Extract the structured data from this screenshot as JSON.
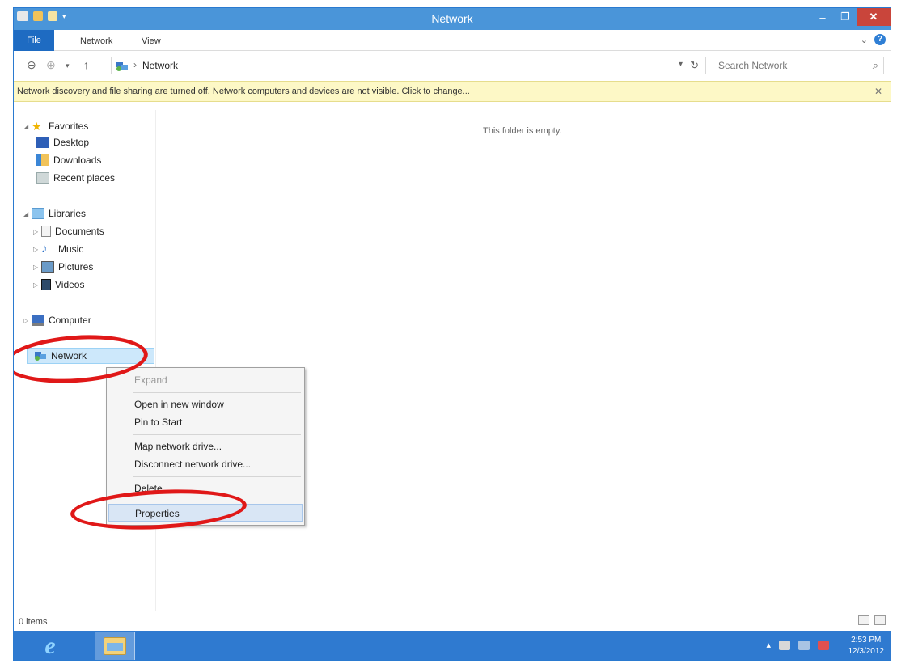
{
  "window": {
    "title": "Network"
  },
  "ribbon": {
    "tabs": [
      "File",
      "Network",
      "View"
    ]
  },
  "address_bar": {
    "crumb": "Network",
    "separator": "›",
    "search_placeholder": "Search Network"
  },
  "info_bar": {
    "message": "Network discovery and file sharing are turned off. Network computers and devices are not visible. Click to change..."
  },
  "nav_pane": {
    "favorites": {
      "label": "Favorites",
      "items": [
        "Desktop",
        "Downloads",
        "Recent places"
      ]
    },
    "libraries": {
      "label": "Libraries",
      "items": [
        "Documents",
        "Music",
        "Pictures",
        "Videos"
      ]
    },
    "computer": "Computer",
    "network": "Network"
  },
  "content": {
    "empty_message": "This folder is empty."
  },
  "context_menu": {
    "items": [
      "Expand",
      "Open in new window",
      "Pin to Start",
      "Map network drive...",
      "Disconnect network drive...",
      "Delete",
      "Properties"
    ],
    "highlighted": "Properties"
  },
  "status_bar": {
    "item_count": "0 items"
  },
  "taskbar": {
    "time": "2:53 PM",
    "date": "12/3/2012"
  },
  "colors": {
    "titlebar": "#4a95d9",
    "taskbar": "#2f7ad0",
    "annotation": "#e01818",
    "infobar": "#fdf8c6"
  },
  "icons": [
    "explorer-icon",
    "new-folder-icon",
    "back-icon",
    "forward-icon",
    "up-icon",
    "network-icon",
    "refresh-icon",
    "search-icon",
    "close-icon",
    "star-icon",
    "desktop-icon",
    "downloads-icon",
    "recent-places-icon",
    "library-icon",
    "documents-icon",
    "music-icon",
    "pictures-icon",
    "videos-icon",
    "computer-icon",
    "ie-icon",
    "folder-icon"
  ]
}
